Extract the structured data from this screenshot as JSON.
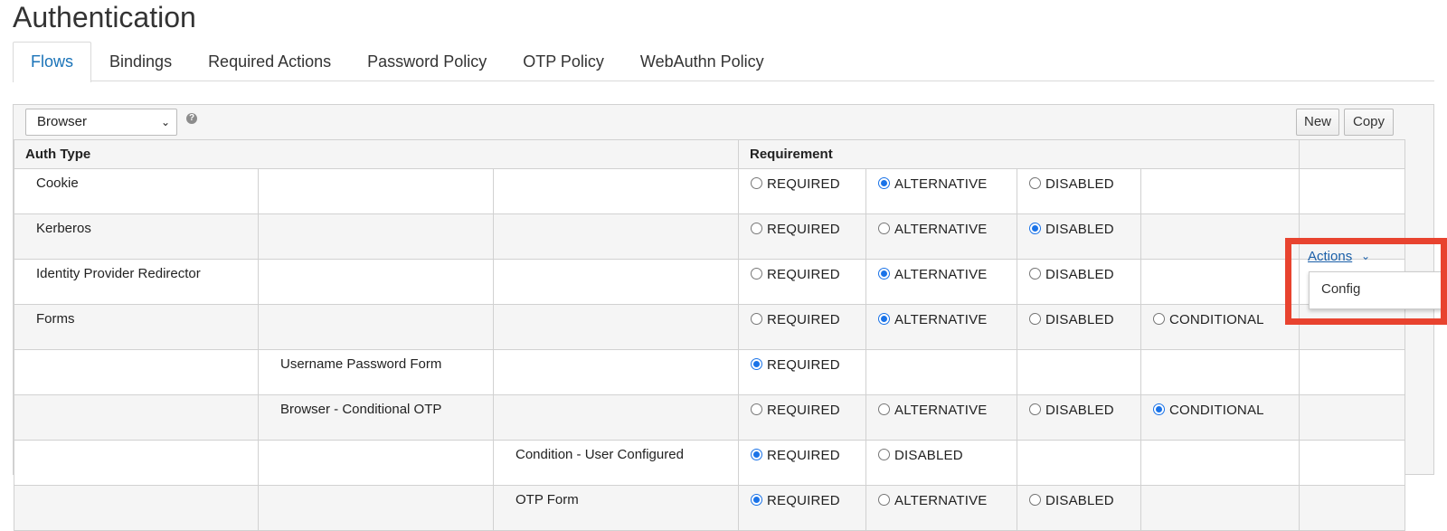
{
  "header": {
    "title": "Authentication"
  },
  "tabs": [
    {
      "label": "Flows",
      "active": true
    },
    {
      "label": "Bindings"
    },
    {
      "label": "Required Actions"
    },
    {
      "label": "Password Policy"
    },
    {
      "label": "OTP Policy"
    },
    {
      "label": "WebAuthn Policy"
    }
  ],
  "toolbar": {
    "flow_select": "Browser",
    "help_icon": "?",
    "new_label": "New",
    "copy_label": "Copy"
  },
  "table": {
    "headers": {
      "auth_type": "Auth Type",
      "requirement": "Requirement"
    },
    "rows": [
      {
        "level": 0,
        "name": "Cookie",
        "options": [
          {
            "label": "REQUIRED",
            "checked": false
          },
          {
            "label": "ALTERNATIVE",
            "checked": true
          },
          {
            "label": "DISABLED",
            "checked": false
          }
        ]
      },
      {
        "level": 0,
        "name": "Kerberos",
        "options": [
          {
            "label": "REQUIRED",
            "checked": false
          },
          {
            "label": "ALTERNATIVE",
            "checked": false
          },
          {
            "label": "DISABLED",
            "checked": true
          }
        ]
      },
      {
        "level": 0,
        "name": "Identity Provider Redirector",
        "options": [
          {
            "label": "REQUIRED",
            "checked": false
          },
          {
            "label": "ALTERNATIVE",
            "checked": true
          },
          {
            "label": "DISABLED",
            "checked": false
          }
        ]
      },
      {
        "level": 0,
        "name": "Forms",
        "options": [
          {
            "label": "REQUIRED",
            "checked": false
          },
          {
            "label": "ALTERNATIVE",
            "checked": true
          },
          {
            "label": "DISABLED",
            "checked": false
          },
          {
            "label": "CONDITIONAL",
            "checked": false
          }
        ]
      },
      {
        "level": 1,
        "name": "Username Password Form",
        "options": [
          {
            "label": "REQUIRED",
            "checked": true
          }
        ]
      },
      {
        "level": 1,
        "name": "Browser - Conditional OTP",
        "options": [
          {
            "label": "REQUIRED",
            "checked": false
          },
          {
            "label": "ALTERNATIVE",
            "checked": false
          },
          {
            "label": "DISABLED",
            "checked": false
          },
          {
            "label": "CONDITIONAL",
            "checked": true
          }
        ]
      },
      {
        "level": 2,
        "name": "Condition - User Configured",
        "options": [
          {
            "label": "REQUIRED",
            "checked": true
          },
          {
            "label": "DISABLED",
            "checked": false
          }
        ]
      },
      {
        "level": 2,
        "name": "OTP Form",
        "options": [
          {
            "label": "REQUIRED",
            "checked": true
          },
          {
            "label": "ALTERNATIVE",
            "checked": false
          },
          {
            "label": "DISABLED",
            "checked": false
          }
        ]
      }
    ]
  },
  "actions_menu": {
    "label": "Actions",
    "chevron_icon": "chevron-down-icon",
    "items": [
      "Config"
    ]
  },
  "colors": {
    "accent": "#1a73e8",
    "highlight": "#e8432f",
    "link": "#1a5fa8"
  }
}
